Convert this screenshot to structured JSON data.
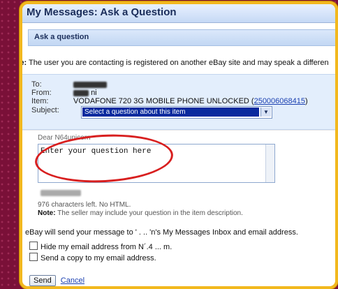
{
  "window": {
    "title": "My Messages: Ask a Question"
  },
  "section": {
    "title": "Ask a question"
  },
  "note": {
    "label": "Note:",
    "text": "The user you are contacting is registered on another eBay site and may speak a differen"
  },
  "fields": {
    "to_label": "To:",
    "from_label": "From:",
    "from_value_tail": "ni",
    "item_label": "Item:",
    "item_value": "VODAFONE 720 3G MOBILE PHONE UNLOCKED (",
    "item_link": "250006068415",
    "item_close": ")",
    "subject_label": "Subject:",
    "subject_selected": "Select a question about this item"
  },
  "message": {
    "dear": "Dear N64unicorn",
    "placeholder": "Enter your question here"
  },
  "chars_left": "976 characters left. No HTML.",
  "seller_note": {
    "label": "Note:",
    "text": "The seller may include your question in the item description."
  },
  "send_to": "eBay will send your message to '  .      ..  'n's My Messages Inbox and email address.",
  "checkboxes": [
    {
      "label": "Hide my email address from N´.4     ...  m.",
      "checked": false
    },
    {
      "label": "Send a copy to my email address.",
      "checked": false
    }
  ],
  "buttons": {
    "send": "Send",
    "cancel": "Cancel"
  },
  "colors": {
    "accent_border": "#f2b81e",
    "annotation": "#d81f1f",
    "link": "#1a3fb0"
  }
}
